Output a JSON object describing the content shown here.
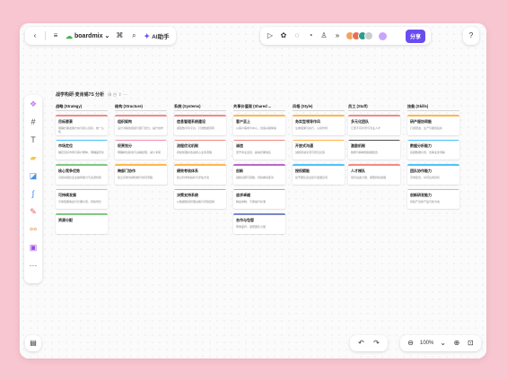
{
  "toolbar": {
    "back": "‹",
    "menu": "≡",
    "brand": "boardmix",
    "brand_caret": "⌄",
    "tag": "⌘",
    "search": "⌕",
    "ai_label": "AI助手"
  },
  "actions": {
    "more": "»",
    "share_label": "分享",
    "help": "?"
  },
  "board": {
    "title": "战学构研·麦肯锡7S 分析",
    "meta": "⊞ ◷ ⇪ ···"
  },
  "zoom": {
    "minus": "⊖",
    "level": "100%",
    "level_caret": "⌄",
    "plus": "⊕",
    "fit": "⊡"
  },
  "undo": "↶",
  "redo": "↷",
  "columns": [
    {
      "header": "战略 (Strategy)",
      "cards": [
        {
          "title": "目标愿景",
          "desc": "明确长期发展方向与核心目标，统一认知",
          "color": "#f28b82"
        },
        {
          "title": "市场定位",
          "desc": "确定目标市场与客户群体，明确差异化",
          "color": "#4fc3f7"
        },
        {
          "title": "核心竞争优势",
          "desc": "识别并强化企业独特能力与资源优势",
          "color": "#81c784"
        },
        {
          "title": "可持续发展",
          "desc": "平衡短期收益与长期价值，持续增长",
          "color": "#ffb74d"
        },
        {
          "title": "资源分配",
          "desc": "",
          "color": "#81c784"
        }
      ]
    },
    {
      "header": "结构 (Structure)",
      "cards": [
        {
          "title": "组织架构",
          "desc": "设计清晰的层级与部门划分，提升协作",
          "color": "#f28b82"
        },
        {
          "title": "权责划分",
          "desc": "明确岗位职责与决策权限，减少冲突",
          "color": "#f48fb1"
        },
        {
          "title": "跨部门协作",
          "desc": "建立高效沟通机制与协同流程",
          "color": "#ffb74d"
        }
      ]
    },
    {
      "header": "系统 (Systems)",
      "cards": [
        {
          "title": "信息管理系统建设",
          "desc": "搭建数字化平台，打通数据流转",
          "color": "#f28b82"
        },
        {
          "title": "流程优化机制",
          "desc": "持续梳理并改进核心业务流程",
          "color": "#f28b82"
        },
        {
          "title": "绩效考核体系",
          "desc": "建立科学的指标与评估方法",
          "color": "#ffb74d"
        },
        {
          "title": "决策支持系统",
          "desc": "以数据驱动管理决策与风险控制",
          "color": "#f48fb1"
        }
      ]
    },
    {
      "header": "共享价值观 (Shared ...",
      "cards": [
        {
          "title": "客户至上",
          "desc": "以客户需求为中心，创造卓越体验",
          "color": "#ffb74d"
        },
        {
          "title": "诚信",
          "desc": "坚守商业道德，赢得长期信任",
          "color": "#f28b82"
        },
        {
          "title": "创新",
          "desc": "鼓励试错与突破，持续推动变革",
          "color": "#ba68c8"
        },
        {
          "title": "追求卓越",
          "desc": "精益求精，不断提升标准",
          "color": "#81c784"
        },
        {
          "title": "合作与包容",
          "desc": "尊重差异，凝聚团队力量",
          "color": "#7986cb"
        }
      ]
    },
    {
      "header": "风格 (Style)",
      "cards": [
        {
          "title": "务实型领导作风",
          "desc": "注重结果与执行，以身作则",
          "color": "#ffb74d"
        },
        {
          "title": "开放式沟通",
          "desc": "鼓励坦诚交流与意见反馈",
          "color": "#ffb74d"
        },
        {
          "title": "授权赋能",
          "desc": "给予团队自主权与发展空间",
          "color": "#4fc3f7"
        }
      ]
    },
    {
      "header": "员工 (Staff)",
      "cards": [
        {
          "title": "多元化团队",
          "desc": "汇聚不同背景与专业人才",
          "color": "#f28b82"
        },
        {
          "title": "激励机制",
          "desc": "物质与精神激励相结合",
          "color": "#555555"
        },
        {
          "title": "人才梯队",
          "desc": "培养后备力量，保障持续发展",
          "color": "#f28b82"
        }
      ]
    },
    {
      "header": "技能 (Skills)",
      "cards": [
        {
          "title": "研产服协同能",
          "desc": "打通研发、生产与服务链条",
          "color": "#ffb74d"
        },
        {
          "title": "数据分析能力",
          "desc": "挖掘数据价值，支撑业务洞察",
          "color": "#4fc3f7"
        },
        {
          "title": "团队协作能力",
          "desc": "高效配合，共同达成目标",
          "color": "#4fc3f7"
        },
        {
          "title": "创新研发能力",
          "desc": "持续产出新产品与新方案",
          "color": "#ffb74d"
        }
      ]
    }
  ]
}
